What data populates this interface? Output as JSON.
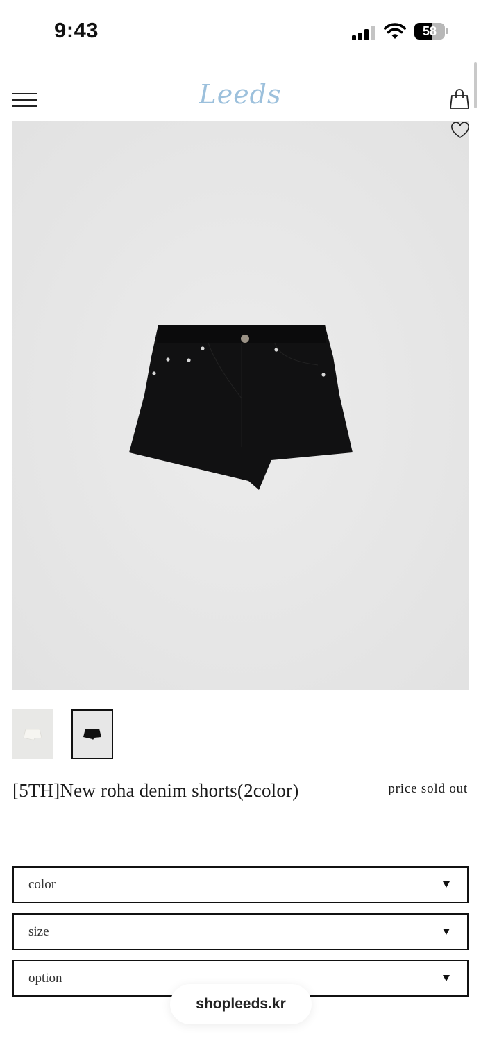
{
  "status_bar": {
    "time": "9:43",
    "battery_level": "58",
    "battery_fraction": 0.58
  },
  "header": {
    "logo": "Leeds",
    "logo_color": "#9cc0dc",
    "menu_icon": "hamburger-menu-icon",
    "cart_icon": "shopping-bag-icon"
  },
  "product": {
    "wishlist_icon": "heart-outline-icon",
    "title": "[5TH]New roha denim shorts(2color)",
    "price": "price sold out",
    "thumbnails": [
      {
        "color": "white",
        "selected": false
      },
      {
        "color": "black",
        "selected": true
      }
    ]
  },
  "options": [
    {
      "label": "color"
    },
    {
      "label": "size"
    },
    {
      "label": "option"
    }
  ],
  "browser": {
    "url": "shopleeds.kr"
  }
}
